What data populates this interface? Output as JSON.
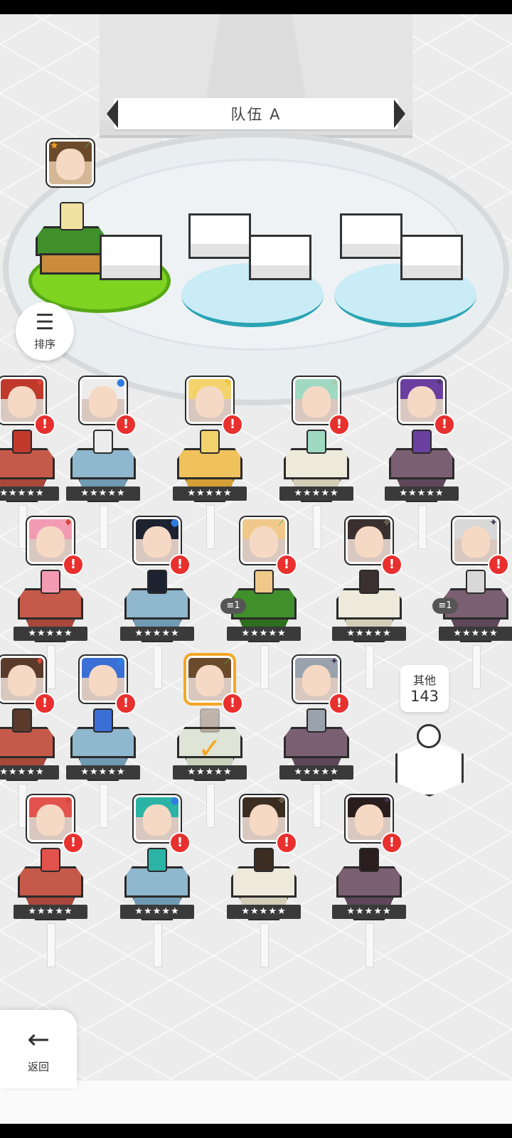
{
  "team": {
    "title": "队伍 A"
  },
  "sort": {
    "label": "排序",
    "icon": "sort-icon"
  },
  "back": {
    "label": "返回",
    "icon": "arrow-left-icon"
  },
  "others": {
    "label": "其他",
    "count": "143"
  },
  "colors": {
    "accent": "#f5a623",
    "alert": "#e8302f",
    "green_pad": "#7fd321",
    "blue_pad": "#c9ecf6"
  },
  "leader": {
    "element": "nature",
    "star": true
  },
  "heroes": [
    {
      "row": 0,
      "col": 0,
      "element": "fire",
      "pedestal": "red",
      "hair": "#c0392b",
      "stars": "★★★★★",
      "alert": "!",
      "partial": true
    },
    {
      "row": 0,
      "col": 1,
      "element": "water",
      "pedestal": "blue",
      "hair": "#ececec",
      "stars": "★★★★★",
      "alert": "!"
    },
    {
      "row": 0,
      "col": 2,
      "element": "light",
      "pedestal": "gold",
      "hair": "#f3d36b",
      "stars": "★★★★★",
      "alert": "!"
    },
    {
      "row": 0,
      "col": 3,
      "element": "holy",
      "pedestal": "white",
      "hair": "#9fd9c2",
      "stars": "★★★★★",
      "alert": "!"
    },
    {
      "row": 0,
      "col": 4,
      "element": "dark",
      "pedestal": "purple",
      "hair": "#6b3fa0",
      "stars": "★★★★★",
      "alert": "!"
    },
    {
      "row": 1,
      "col": 0,
      "element": "fire",
      "pedestal": "red",
      "hair": "#f29bb3",
      "stars": "★★★★★",
      "alert": "!"
    },
    {
      "row": 1,
      "col": 1,
      "element": "water",
      "pedestal": "blue",
      "hair": "#1d2230",
      "stars": "★★★★★",
      "alert": "!"
    },
    {
      "row": 1,
      "col": 2,
      "element": "nature",
      "pedestal": "green",
      "hair": "#f0c98a",
      "stars": "★★★★★",
      "alert": "!",
      "count": "1"
    },
    {
      "row": 1,
      "col": 3,
      "element": "holy",
      "pedestal": "white",
      "hair": "#3a3030",
      "stars": "★★★★★",
      "alert": "!"
    },
    {
      "row": 1,
      "col": 4,
      "element": "dark",
      "pedestal": "purple",
      "hair": "#d8d8d8",
      "stars": "★★★★★",
      "alert": "!",
      "count": "1"
    },
    {
      "row": 2,
      "col": 0,
      "element": "fire",
      "pedestal": "red",
      "hair": "#5a3a2a",
      "stars": "★★★★★",
      "alert": "!",
      "partial": true
    },
    {
      "row": 2,
      "col": 1,
      "element": "water",
      "pedestal": "blue",
      "hair": "#3b6fd6",
      "stars": "★★★★★",
      "alert": "!"
    },
    {
      "row": 2,
      "col": 2,
      "element": "nature",
      "pedestal": "selected",
      "hair": "#6b4a2b",
      "stars": "★★★★★",
      "alert": "!",
      "selected": true
    },
    {
      "row": 2,
      "col": 3,
      "element": "dark",
      "pedestal": "purple",
      "hair": "#9aa3ad",
      "stars": "★★★★★",
      "alert": "!"
    },
    {
      "row": 3,
      "col": 0,
      "element": "fire",
      "pedestal": "red",
      "hair": "#e2534d",
      "stars": "★★★★★",
      "alert": "!"
    },
    {
      "row": 3,
      "col": 1,
      "element": "water",
      "pedestal": "blue",
      "hair": "#2bb3a6",
      "stars": "★★★★★",
      "alert": "!"
    },
    {
      "row": 3,
      "col": 2,
      "element": "holy",
      "pedestal": "white",
      "hair": "#3c2d22",
      "stars": "★★★★★",
      "alert": "!"
    },
    {
      "row": 3,
      "col": 3,
      "element": "dark",
      "pedestal": "purple",
      "hair": "#2a1d1d",
      "stars": "★★★★★",
      "alert": "!"
    }
  ]
}
